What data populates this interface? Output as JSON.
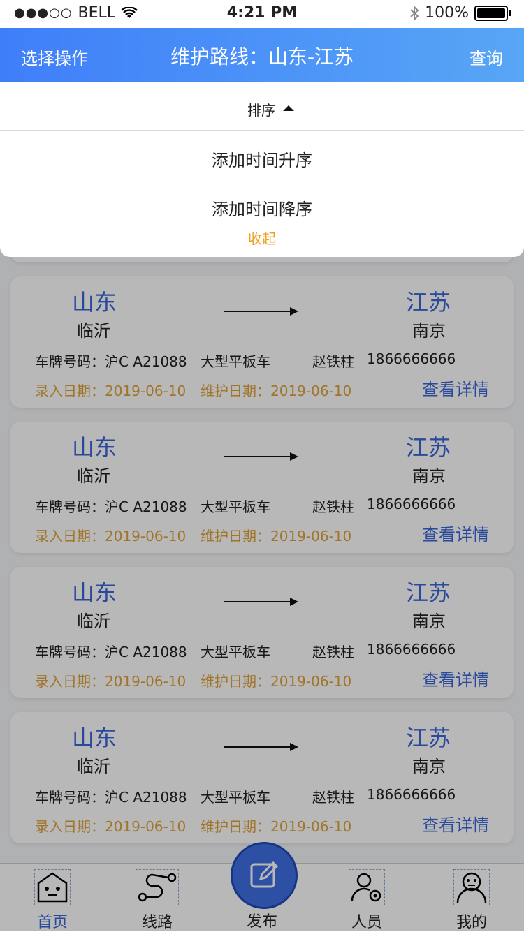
{
  "status_bar": {
    "signal": "●●●○○",
    "carrier": "BELL",
    "time": "4:21 PM",
    "battery": "100%"
  },
  "header": {
    "left_action": "选择操作",
    "title": "维护路线：山东-江苏",
    "right_action": "查询"
  },
  "sort": {
    "label": "排序",
    "options": [
      "添加时间升序",
      "添加时间降序"
    ],
    "collapse": "收起"
  },
  "cards": [
    {
      "from_prov": "山东",
      "from_city": "临沂",
      "to_prov": "江苏",
      "to_city": "南京",
      "plate": "车牌号码：沪C A21088",
      "vehicle_type": "大型平板车",
      "driver": "赵铁柱",
      "phone": "1866666666",
      "record_date": "录入日期：2019-06-10",
      "maintain_date": "维护日期：2019-06-10",
      "detail": "查看详情"
    },
    {
      "from_prov": "山东",
      "from_city": "临沂",
      "to_prov": "江苏",
      "to_city": "南京",
      "plate": "车牌号码：沪C A21088",
      "vehicle_type": "大型平板车",
      "driver": "赵铁柱",
      "phone": "1866666666",
      "record_date": "录入日期：2019-06-10",
      "maintain_date": "维护日期：2019-06-10",
      "detail": "查看详情"
    },
    {
      "from_prov": "山东",
      "from_city": "临沂",
      "to_prov": "江苏",
      "to_city": "南京",
      "plate": "车牌号码：沪C A21088",
      "vehicle_type": "大型平板车",
      "driver": "赵铁柱",
      "phone": "1866666666",
      "record_date": "录入日期：2019-06-10",
      "maintain_date": "维护日期：2019-06-10",
      "detail": "查看详情"
    },
    {
      "from_prov": "山东",
      "from_city": "临沂",
      "to_prov": "江苏",
      "to_city": "南京",
      "plate": "车牌号码：沪C A21088",
      "vehicle_type": "大型平板车",
      "driver": "赵铁柱",
      "phone": "1866666666",
      "record_date": "录入日期：2019-06-10",
      "maintain_date": "维护日期：2019-06-10",
      "detail": "查看详情"
    },
    {
      "from_prov": "山东",
      "from_city": "临沂",
      "to_prov": "江苏",
      "to_city": "南京",
      "plate": "车牌号码：沪C A21088",
      "vehicle_type": "大型平板车",
      "driver": "赵铁柱",
      "phone": "1866666666",
      "record_date": "录入日期：2019-06-10",
      "maintain_date": "维护日期：2019-06-10",
      "detail": "查看详情"
    }
  ],
  "tabbar": {
    "home": "首页",
    "route": "线路",
    "publish": "发布",
    "people": "人员",
    "mine": "我的"
  },
  "colors": {
    "accent": "#3a66d8",
    "date": "#e0a23a",
    "collapse": "#f0a020",
    "header_start": "#3f7ef9",
    "header_end": "#58a6f6"
  }
}
